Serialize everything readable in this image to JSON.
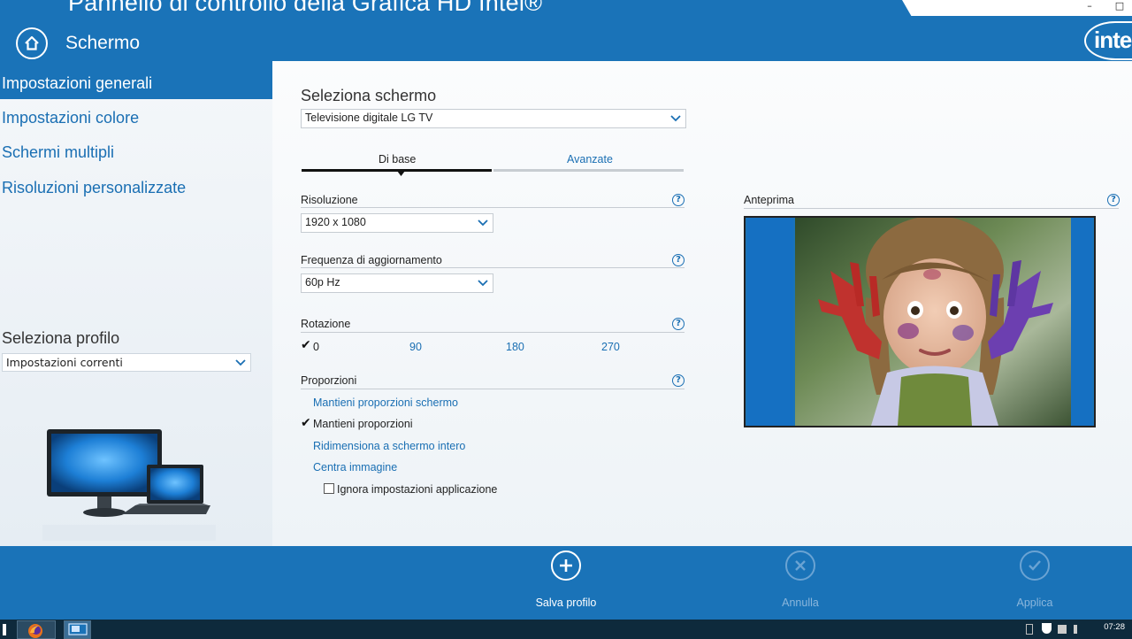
{
  "header": {
    "app_title": "Pannello di controllo della Grafica HD Intel®",
    "section_title": "Schermo",
    "logo_text": "intel",
    "window_buttons": [
      "–",
      "□"
    ]
  },
  "sidebar": {
    "items": [
      {
        "label": "Impostazioni generali",
        "active": true
      },
      {
        "label": "Impostazioni colore",
        "active": false
      },
      {
        "label": "Schermi multipli",
        "active": false
      },
      {
        "label": "Risoluzioni personalizzate",
        "active": false
      }
    ],
    "profile_label": "Seleziona profilo",
    "profile_value": "Impostazioni correnti"
  },
  "main": {
    "select_display_label": "Seleziona schermo",
    "select_display_value": "Televisione digitale LG TV",
    "tabs": [
      {
        "label": "Di base",
        "active": true
      },
      {
        "label": "Avanzate",
        "active": false
      }
    ],
    "resolution_label": "Risoluzione",
    "resolution_value": "1920 x 1080",
    "refresh_label": "Frequenza di aggiornamento",
    "refresh_value": "60p Hz",
    "rotation_label": "Rotazione",
    "rotation_options": [
      "0",
      "90",
      "180",
      "270"
    ],
    "rotation_selected": "0",
    "proportions_label": "Proporzioni",
    "proportion_options": [
      {
        "label": "Mantieni proporzioni schermo",
        "selected": false
      },
      {
        "label": "Mantieni proporzioni",
        "selected": true
      },
      {
        "label": "Ridimensiona a schermo intero",
        "selected": false
      },
      {
        "label": "Centra immagine",
        "selected": false
      }
    ],
    "ignore_app_settings_label": "Ignora impostazioni applicazione",
    "ignore_app_settings_checked": false,
    "preview_label": "Anteprima",
    "help_glyph": "?"
  },
  "actions": {
    "save_profile": "Salva profilo",
    "cancel": "Annulla",
    "apply": "Applica"
  },
  "taskbar": {
    "clock": "07:28"
  },
  "colors": {
    "accent": "#1a73b8",
    "link": "#1a6fb3"
  }
}
